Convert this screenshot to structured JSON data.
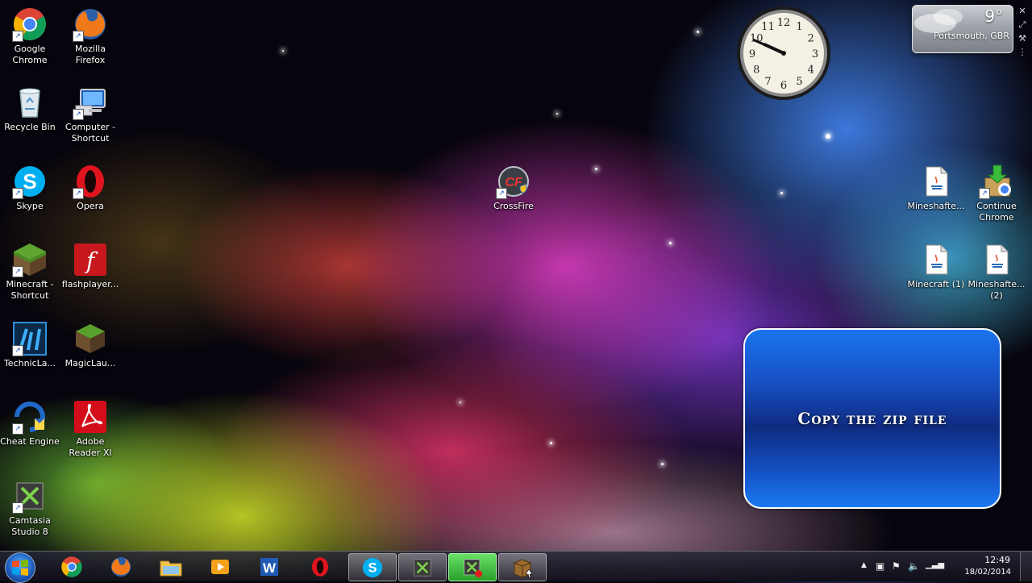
{
  "desktop": {
    "icons_left": [
      {
        "label": "Google Chrome",
        "icon": "chrome-icon"
      },
      {
        "label": "Mozilla Firefox",
        "icon": "firefox-icon"
      },
      {
        "label": "Recycle Bin",
        "icon": "recycle-bin-icon"
      },
      {
        "label": "Computer - Shortcut",
        "icon": "computer-icon"
      },
      {
        "label": "Skype",
        "icon": "skype-icon"
      },
      {
        "label": "Opera",
        "icon": "opera-icon"
      },
      {
        "label": "Minecraft - Shortcut",
        "icon": "minecraft-icon"
      },
      {
        "label": "flashplayer...",
        "icon": "flash-icon"
      },
      {
        "label": "TechnicLa...",
        "icon": "technic-launcher-icon"
      },
      {
        "label": "MagicLau...",
        "icon": "magic-launcher-icon"
      },
      {
        "label": "Cheat Engine",
        "icon": "cheat-engine-icon"
      },
      {
        "label": "Adobe Reader XI",
        "icon": "adobe-reader-icon"
      },
      {
        "label": "Camtasia Studio 8",
        "icon": "camtasia-icon"
      }
    ],
    "icon_crossfire": {
      "label": "CrossFire",
      "icon": "crossfire-icon"
    },
    "icons_right": [
      {
        "label": "Mineshafte...",
        "icon": "java-file-icon"
      },
      {
        "label": "Continue Chrome",
        "icon": "chrome-installer-icon"
      },
      {
        "label": "Minecraft (1)",
        "icon": "java-file-icon"
      },
      {
        "label": "Mineshafte... (2)",
        "icon": "java-file-icon"
      }
    ]
  },
  "gadgets": {
    "clock": {
      "hour": 9,
      "minute": 49,
      "numerals": [
        "12",
        "1",
        "2",
        "3",
        "4",
        "5",
        "6",
        "7",
        "8",
        "9",
        "10",
        "11"
      ]
    },
    "weather": {
      "temperature": "9°",
      "location": "Portsmouth, GBR"
    }
  },
  "overlay": {
    "text": "Copy the zip file"
  },
  "taskbar": {
    "time": "12:49",
    "date": "18/02/2014",
    "pinned": [
      "chrome-icon",
      "firefox-icon",
      "explorer-icon",
      "media-player-icon",
      "word-icon",
      "opera-icon",
      "skype-icon",
      "camtasia-icon",
      "camtasia-recorder-icon",
      "winrar-icon"
    ]
  },
  "colors": {
    "callout_blue": "#1a74ef",
    "taskbar_green": "#2a9f2a"
  }
}
